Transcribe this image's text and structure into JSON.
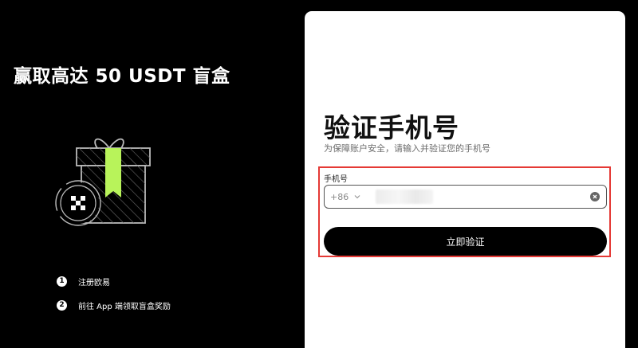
{
  "promo": {
    "title": "赢取高达 50 USDT 盲盒",
    "steps": [
      {
        "num": "1",
        "label": "注册欧易"
      },
      {
        "num": "2",
        "label": "前往 App 端领取盲盒奖励"
      }
    ]
  },
  "form": {
    "title": "验证手机号",
    "subtitle": "为保障账户安全，请输入并验证您的手机号",
    "phone_label": "手机号",
    "country_code": "+86",
    "submit_label": "立即验证"
  },
  "colors": {
    "accent": "#b8f35a",
    "highlight_border": "#e53935",
    "background": "#000000",
    "card": "#ffffff"
  },
  "icons": {
    "gift": "gift-box-icon",
    "logo": "okx-logo-icon",
    "chevron": "chevron-down-icon",
    "clear": "clear-icon"
  }
}
